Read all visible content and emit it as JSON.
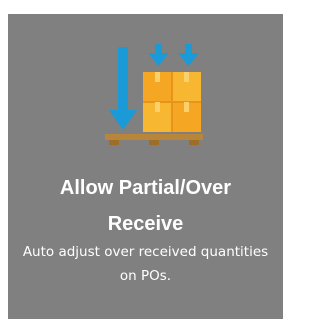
{
  "card": {
    "icon": "pallet-receive-icon",
    "title_line1": "Allow Partial/Over",
    "title_line2": "Receive",
    "description": "Auto adjust over received quantities on POs.",
    "colors": {
      "background": "#808080",
      "arrow": "#1a9ad6",
      "box": "#f7b731",
      "box_tape": "#f39c12",
      "pallet": "#b8863b",
      "text": "#ffffff"
    }
  }
}
